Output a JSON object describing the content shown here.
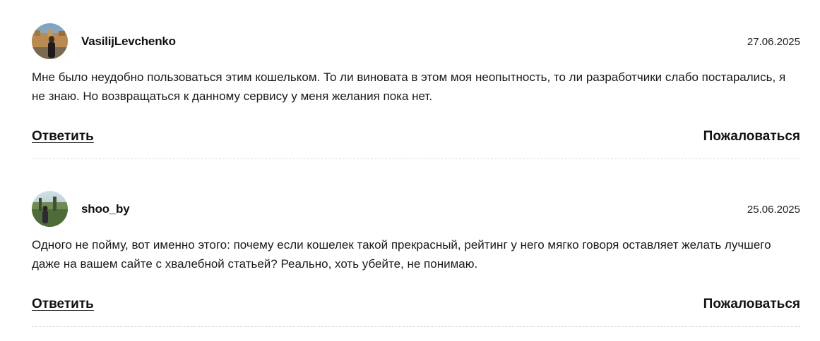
{
  "comments": [
    {
      "author": "VasilijLevchenko",
      "date": "27.06.2025",
      "text": "Мне было неудобно пользоваться этим кошельком. То ли виновата в этом моя неопытность, то ли разработчики слабо постарались, я не знаю. Но возвращаться к данному сервису у меня желания пока нет.",
      "reply_label": "Ответить",
      "report_label": "Пожаловаться"
    },
    {
      "author": "shoo_by",
      "date": "25.06.2025",
      "text": "Одного не пойму, вот именно этого: почему если кошелек такой прекрасный, рейтинг у него мягко говоря оставляет желать лучшего даже на вашем сайте с хвалебной статьей? Реально, хоть убейте, не понимаю.",
      "reply_label": "Ответить",
      "report_label": "Пожаловаться"
    }
  ]
}
